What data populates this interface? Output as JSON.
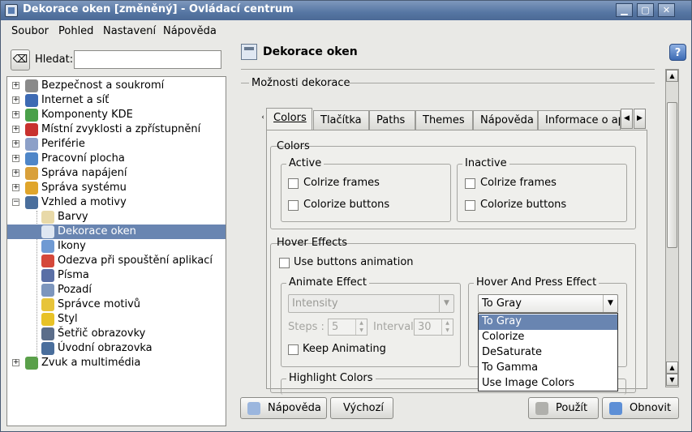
{
  "window": {
    "title": "Dekorace oken [změněný] - Ovládací centrum"
  },
  "menubar": {
    "items": [
      "Soubor",
      "Pohled",
      "Nastavení",
      "Nápověda"
    ]
  },
  "search": {
    "label": "Hledat:",
    "value": ""
  },
  "tree": {
    "items": [
      {
        "label": "Bezpečnost a soukromí",
        "icon": "security-icon",
        "color": "#8a8a8a",
        "level": 0,
        "expander": "+"
      },
      {
        "label": "Internet a síť",
        "icon": "globe-icon",
        "color": "#3d6ab3",
        "level": 0,
        "expander": "+"
      },
      {
        "label": "Komponenty KDE",
        "icon": "components-icon",
        "color": "#4aa04a",
        "level": 0,
        "expander": "+"
      },
      {
        "label": "Místní zvyklosti a zpřístupnění",
        "icon": "flag-icon",
        "color": "#c8322e",
        "level": 0,
        "expander": "+"
      },
      {
        "label": "Periférie",
        "icon": "devices-icon",
        "color": "#8ca0c8",
        "level": 0,
        "expander": "+"
      },
      {
        "label": "Pracovní plocha",
        "icon": "desktop-icon",
        "color": "#4f86c8",
        "level": 0,
        "expander": "+"
      },
      {
        "label": "Správa napájení",
        "icon": "power-icon",
        "color": "#d9a03a",
        "level": 0,
        "expander": "+"
      },
      {
        "label": "Správa systému",
        "icon": "system-icon",
        "color": "#e0a52b",
        "level": 0,
        "expander": "+"
      },
      {
        "label": "Vzhled a motivy",
        "icon": "appearance-icon",
        "color": "#4a6e9c",
        "level": 0,
        "expander": "−"
      },
      {
        "label": "Barvy",
        "icon": "colors-icon",
        "color": "#e8d9a8",
        "level": 1,
        "expander": ""
      },
      {
        "label": "Dekorace oken",
        "icon": "window-decoration-icon",
        "color": "#dfe7f2",
        "level": 1,
        "expander": "",
        "selected": true
      },
      {
        "label": "Ikony",
        "icon": "icons-icon",
        "color": "#6f9ad3",
        "level": 1,
        "expander": ""
      },
      {
        "label": "Odezva při spouštění aplikací",
        "icon": "launch-feedback-icon",
        "color": "#d5483a",
        "level": 1,
        "expander": ""
      },
      {
        "label": "Písma",
        "icon": "fonts-icon",
        "color": "#5a6fa6",
        "level": 1,
        "expander": ""
      },
      {
        "label": "Pozadí",
        "icon": "background-icon",
        "color": "#7d96bd",
        "level": 1,
        "expander": ""
      },
      {
        "label": "Správce motivů",
        "icon": "theme-manager-icon",
        "color": "#e7c43a",
        "level": 1,
        "expander": ""
      },
      {
        "label": "Styl",
        "icon": "style-icon",
        "color": "#e8c227",
        "level": 1,
        "expander": ""
      },
      {
        "label": "Šetřič obrazovky",
        "icon": "screensaver-icon",
        "color": "#5b6d8a",
        "level": 1,
        "expander": ""
      },
      {
        "label": "Úvodní obrazovka",
        "icon": "splash-screen-icon",
        "color": "#4a6e9c",
        "level": 1,
        "expander": ""
      },
      {
        "label": "Zvuk a multimédia",
        "icon": "sound-icon",
        "color": "#5aa04a",
        "level": 0,
        "expander": "+"
      }
    ]
  },
  "page": {
    "title": "Dekorace oken",
    "section_label": "Možnosti dekorace"
  },
  "tabs": [
    "Colors",
    "Tlačítka",
    "Paths",
    "Themes",
    "Nápověda",
    "Informace o apli"
  ],
  "colors_group": {
    "title": "Colors",
    "active": {
      "title": "Active",
      "frames": "Colrize frames",
      "buttons": "Colorize buttons"
    },
    "inactive": {
      "title": "Inactive",
      "frames": "Colrize frames",
      "buttons": "Colorize buttons"
    }
  },
  "hover": {
    "title": "Hover Effects",
    "use_animation": "Use buttons animation",
    "animate": {
      "title": "Animate Effect",
      "combo_value": "Intensity",
      "steps_label": "Steps :",
      "steps_value": "5",
      "interval_label": "Interval",
      "interval_value": "30",
      "keep": "Keep Animating"
    },
    "press": {
      "title": "Hover And Press Effect",
      "combo_value": "To Gray"
    }
  },
  "highlight": {
    "title": "Highlight Colors"
  },
  "popup": {
    "options": [
      "To Gray",
      "Colorize",
      "DeSaturate",
      "To Gamma",
      "Use Image Colors"
    ],
    "selected_index": 0
  },
  "buttons": {
    "help": "Nápověda",
    "defaults": "Výchozí",
    "apply": "Použít",
    "reset": "Obnovit"
  }
}
